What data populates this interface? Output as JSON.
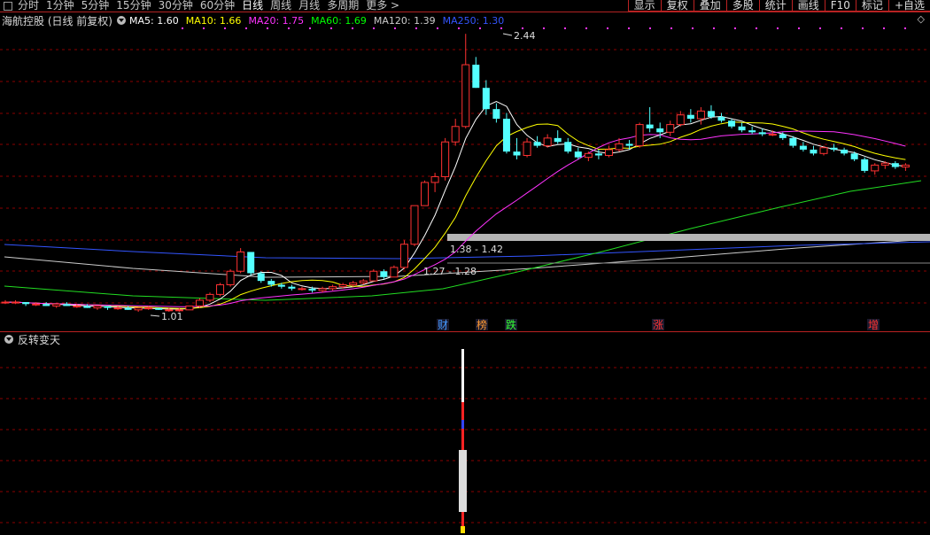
{
  "toolbar": {
    "periods": [
      "分时",
      "1分钟",
      "5分钟",
      "15分钟",
      "30分钟",
      "60分钟",
      "日线",
      "周线",
      "月线",
      "多周期",
      "更多 >"
    ],
    "active_period": "日线",
    "right_buttons": [
      "显示",
      "复权",
      "叠加",
      "多股",
      "统计",
      "画线",
      "F10",
      "标记",
      "+自选"
    ]
  },
  "header": {
    "stock_name": "海航控股 (日线 前复权)",
    "ma_items": [
      {
        "label": "MA5: 1.60",
        "color": "#ffffff"
      },
      {
        "label": "MA10: 1.66",
        "color": "#ffff00"
      },
      {
        "label": "MA20: 1.75",
        "color": "#ff33ff"
      },
      {
        "label": "MA60: 1.69",
        "color": "#00ff00"
      },
      {
        "label": "MA120: 1.39",
        "color": "#cccccc"
      },
      {
        "label": "MA250: 1.30",
        "color": "#3355ff"
      }
    ],
    "right_symbol": "◇"
  },
  "indicator": {
    "name": "反转变天"
  },
  "colors": {
    "up": "#ff3232",
    "down": "#54ffff",
    "grid": "#8b0000",
    "frame": "#b22222"
  },
  "chart_data": {
    "type": "candlestick",
    "annotations": {
      "high_label": "2.44",
      "low_label": "1.01",
      "zone_upper_label": "1.38 - 1.42",
      "zone_lower_label": "1.27 - 1.28"
    },
    "event_markers": [
      {
        "text": "财",
        "color": "#4499ff"
      },
      {
        "text": "榜",
        "color": "#ff9933"
      },
      {
        "text": "跌",
        "color": "#33ff33"
      },
      {
        "text": "涨",
        "color": "#ff3333"
      },
      {
        "text": "增",
        "color": "#ff3333"
      }
    ],
    "candles": [
      [
        1.05,
        1.06,
        1.04,
        1.05
      ],
      [
        1.05,
        1.06,
        1.04,
        1.05
      ],
      [
        1.05,
        1.05,
        1.03,
        1.04
      ],
      [
        1.04,
        1.05,
        1.03,
        1.04
      ],
      [
        1.04,
        1.05,
        1.03,
        1.03
      ],
      [
        1.03,
        1.04,
        1.02,
        1.04
      ],
      [
        1.04,
        1.05,
        1.03,
        1.03
      ],
      [
        1.03,
        1.04,
        1.02,
        1.03
      ],
      [
        1.03,
        1.04,
        1.02,
        1.02
      ],
      [
        1.02,
        1.03,
        1.01,
        1.03
      ],
      [
        1.03,
        1.03,
        1.01,
        1.02
      ],
      [
        1.02,
        1.03,
        1.01,
        1.02
      ],
      [
        1.02,
        1.03,
        1.01,
        1.01
      ],
      [
        1.01,
        1.02,
        1.0,
        1.02
      ],
      [
        1.02,
        1.03,
        1.01,
        1.02
      ],
      [
        1.02,
        1.02,
        1.01,
        1.01
      ],
      [
        1.01,
        1.02,
        1.0,
        1.01
      ],
      [
        1.01,
        1.02,
        1.0,
        1.01
      ],
      [
        1.01,
        1.03,
        1.01,
        1.03
      ],
      [
        1.03,
        1.07,
        1.02,
        1.06
      ],
      [
        1.06,
        1.1,
        1.05,
        1.09
      ],
      [
        1.09,
        1.15,
        1.08,
        1.14
      ],
      [
        1.14,
        1.22,
        1.13,
        1.21
      ],
      [
        1.21,
        1.33,
        1.2,
        1.31
      ],
      [
        1.31,
        1.3,
        1.19,
        1.2
      ],
      [
        1.2,
        1.21,
        1.15,
        1.16
      ],
      [
        1.16,
        1.17,
        1.13,
        1.14
      ],
      [
        1.14,
        1.15,
        1.12,
        1.13
      ],
      [
        1.13,
        1.14,
        1.11,
        1.12
      ],
      [
        1.12,
        1.13,
        1.11,
        1.12
      ],
      [
        1.12,
        1.13,
        1.1,
        1.11
      ],
      [
        1.11,
        1.13,
        1.1,
        1.12
      ],
      [
        1.12,
        1.14,
        1.11,
        1.13
      ],
      [
        1.13,
        1.15,
        1.12,
        1.14
      ],
      [
        1.14,
        1.16,
        1.13,
        1.15
      ],
      [
        1.15,
        1.17,
        1.14,
        1.16
      ],
      [
        1.16,
        1.22,
        1.16,
        1.21
      ],
      [
        1.21,
        1.22,
        1.17,
        1.18
      ],
      [
        1.18,
        1.24,
        1.18,
        1.23
      ],
      [
        1.23,
        1.37,
        1.22,
        1.35
      ],
      [
        1.35,
        1.55,
        1.34,
        1.55
      ],
      [
        1.55,
        1.68,
        1.55,
        1.67
      ],
      [
        1.67,
        1.72,
        1.62,
        1.7
      ],
      [
        1.7,
        1.9,
        1.68,
        1.88
      ],
      [
        1.88,
        2.0,
        1.86,
        1.96
      ],
      [
        1.96,
        2.44,
        1.95,
        2.28
      ],
      [
        2.28,
        2.32,
        2.16,
        2.16
      ],
      [
        2.16,
        2.2,
        2.02,
        2.05
      ],
      [
        2.05,
        2.08,
        1.98,
        2.0
      ],
      [
        2.0,
        2.03,
        1.82,
        1.83
      ],
      [
        1.83,
        1.9,
        1.79,
        1.81
      ],
      [
        1.81,
        1.9,
        1.8,
        1.88
      ],
      [
        1.88,
        1.91,
        1.85,
        1.86
      ],
      [
        1.86,
        1.92,
        1.85,
        1.9
      ],
      [
        1.9,
        1.94,
        1.87,
        1.88
      ],
      [
        1.88,
        1.9,
        1.82,
        1.83
      ],
      [
        1.83,
        1.85,
        1.79,
        1.8
      ],
      [
        1.8,
        1.83,
        1.78,
        1.82
      ],
      [
        1.82,
        1.84,
        1.79,
        1.81
      ],
      [
        1.81,
        1.86,
        1.8,
        1.84
      ],
      [
        1.84,
        1.9,
        1.83,
        1.87
      ],
      [
        1.87,
        1.89,
        1.84,
        1.86
      ],
      [
        1.86,
        1.98,
        1.85,
        1.97
      ],
      [
        1.97,
        2.06,
        1.93,
        1.95
      ],
      [
        1.95,
        1.98,
        1.9,
        1.93
      ],
      [
        1.93,
        1.99,
        1.91,
        1.97
      ],
      [
        1.97,
        2.04,
        1.96,
        2.02
      ],
      [
        2.02,
        2.05,
        1.98,
        2.0
      ],
      [
        2.0,
        2.06,
        1.97,
        2.04
      ],
      [
        2.04,
        2.07,
        2.0,
        2.01
      ],
      [
        2.01,
        2.03,
        1.98,
        1.99
      ],
      [
        1.99,
        2.0,
        1.95,
        1.96
      ],
      [
        1.96,
        1.98,
        1.93,
        1.94
      ],
      [
        1.94,
        1.96,
        1.92,
        1.93
      ],
      [
        1.93,
        1.95,
        1.91,
        1.92
      ],
      [
        1.92,
        1.94,
        1.91,
        1.92
      ],
      [
        1.92,
        1.93,
        1.89,
        1.9
      ],
      [
        1.9,
        1.91,
        1.85,
        1.86
      ],
      [
        1.86,
        1.88,
        1.83,
        1.84
      ],
      [
        1.84,
        1.86,
        1.81,
        1.82
      ],
      [
        1.82,
        1.86,
        1.81,
        1.85
      ],
      [
        1.85,
        1.87,
        1.83,
        1.84
      ],
      [
        1.84,
        1.85,
        1.81,
        1.82
      ],
      [
        1.82,
        1.83,
        1.78,
        1.79
      ],
      [
        1.79,
        1.8,
        1.72,
        1.73
      ],
      [
        1.73,
        1.77,
        1.71,
        1.76
      ],
      [
        1.76,
        1.78,
        1.74,
        1.77
      ],
      [
        1.77,
        1.78,
        1.74,
        1.75
      ],
      [
        1.75,
        1.77,
        1.73,
        1.76
      ]
    ],
    "ma_lines": [
      {
        "name": "MA5",
        "color": "#ffffff"
      },
      {
        "name": "MA10",
        "color": "#ffff00"
      },
      {
        "name": "MA20",
        "color": "#ff33ff"
      },
      {
        "name": "MA60",
        "color": "#00ff00"
      },
      {
        "name": "MA120",
        "color": "#cccccc"
      },
      {
        "name": "MA250",
        "color": "#3355ff"
      }
    ]
  }
}
